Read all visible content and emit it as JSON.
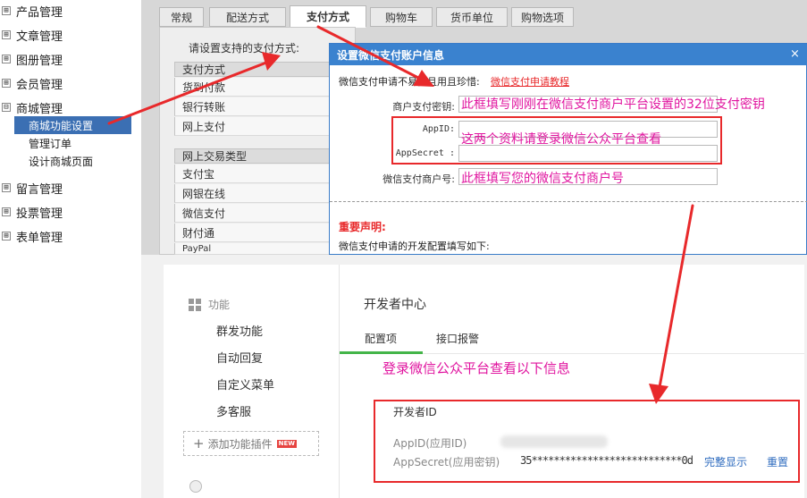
{
  "tree": {
    "top_items": [
      {
        "label": "产品管理",
        "sym": "⊞"
      },
      {
        "label": "文章管理",
        "sym": "⊞"
      },
      {
        "label": "图册管理",
        "sym": "⊞"
      },
      {
        "label": "会员管理",
        "sym": "⊞"
      },
      {
        "label": "商城管理",
        "sym": "⊟"
      }
    ],
    "sub_items": [
      "商城功能设置",
      "管理订单",
      "设计商城页面"
    ],
    "bottom_items": [
      {
        "label": "留言管理",
        "sym": "⊞"
      },
      {
        "label": "投票管理",
        "sym": "⊞"
      },
      {
        "label": "表单管理",
        "sym": "⊞"
      }
    ]
  },
  "tabs": [
    "常规",
    "配送方式",
    "支付方式",
    "购物车",
    "货币单位",
    "购物选项"
  ],
  "config": {
    "prompt": "请设置支持的支付方式:",
    "group1_head": "支付方式",
    "group1_rows": [
      "货到付款",
      "银行转账",
      "网上支付"
    ],
    "group2_head": "网上交易类型",
    "group2_rows": [
      "支付宝",
      "网银在线",
      "微信支付",
      "财付通",
      "PayPal"
    ]
  },
  "dialog": {
    "title": "设置微信支付账户信息",
    "close_glyph": "×",
    "notice": "微信支付申请不易，且用且珍惜:",
    "tutorial_link": "微信支付申请教程",
    "label_key": "商户支付密钥:",
    "label_appid": "AppID:",
    "label_appsecret": "AppSecret :",
    "label_mchid": "微信支付商户号:",
    "important": "重要声明:",
    "dev_config": "微信支付申请的开发配置填写如下:"
  },
  "annotations": {
    "key_hint": "此框填写刚刚在微信支付商户平台设置的32位支付密钥",
    "appid_hint": "这两个资料请登录微信公众平台查看",
    "mchid_hint": "此框填写您的微信支付商户号",
    "login_hint": "登录微信公众平台查看以下信息"
  },
  "wechat": {
    "nav_header": "功能",
    "nav_items": [
      "群发功能",
      "自动回复",
      "自定义菜单",
      "多客服"
    ],
    "add_plugin": "添加功能插件",
    "new_badge": "NEW",
    "page_title": "开发者中心",
    "tab_config": "配置项",
    "tab_api": "接口报警",
    "dev_id_title": "开发者ID",
    "appid_label": "AppID(应用ID)",
    "appsecret_label": "AppSecret(应用密钥)",
    "appsecret_value": "35***************************0d",
    "show_full": "完整显示",
    "reset": "重置"
  },
  "colors": {
    "annotation_red": "#e8292b",
    "annotation_pink": "#e0149f",
    "dialog_blue": "#3a82cf",
    "selected_blue": "#3b6fb3",
    "wechat_green": "#44b549",
    "link_blue": "#2f6cbf"
  }
}
